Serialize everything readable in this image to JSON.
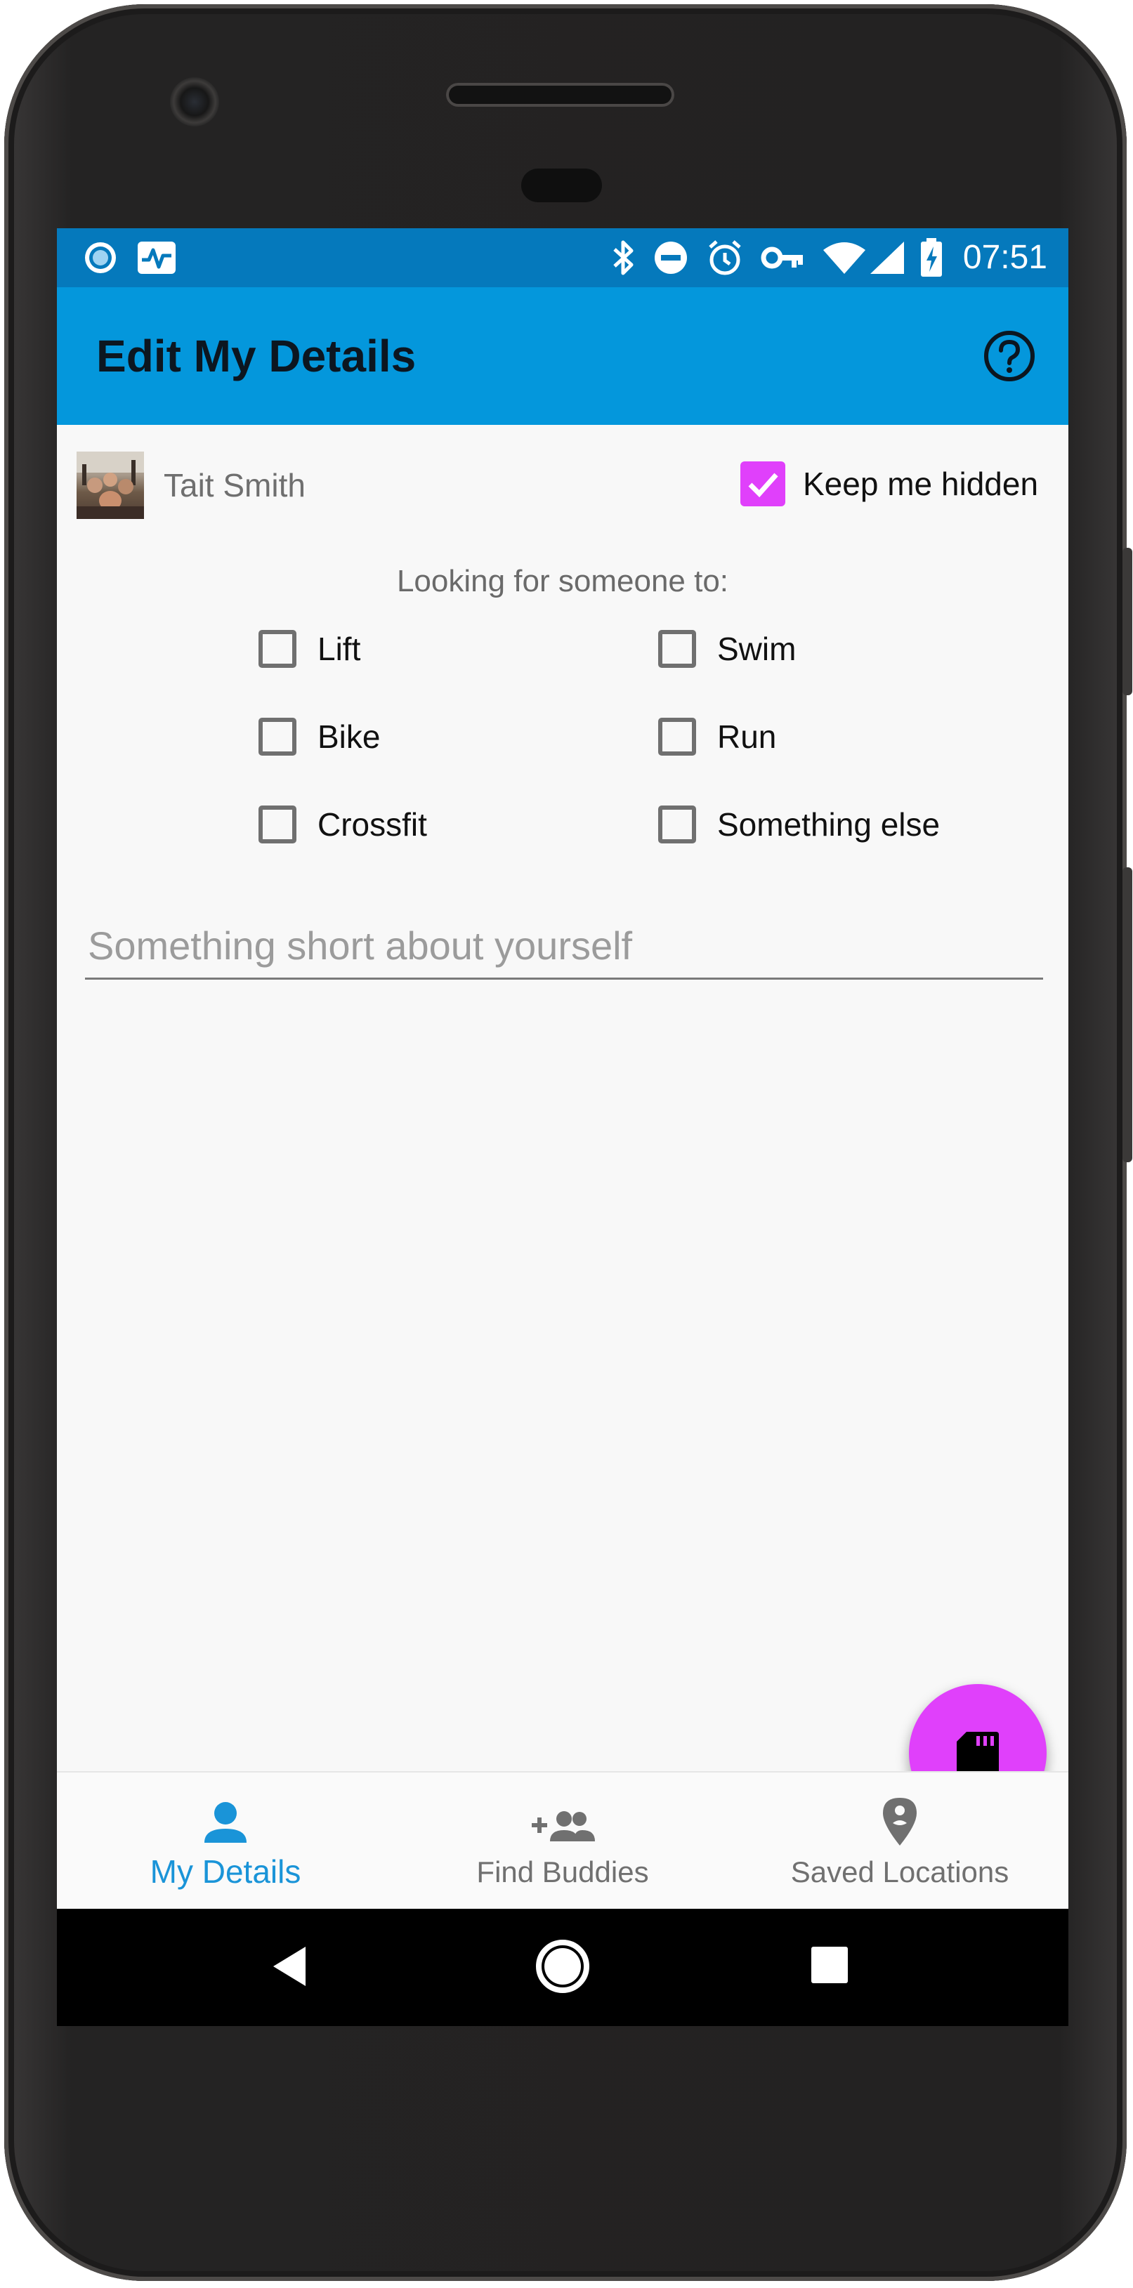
{
  "status_bar": {
    "time": "07:51",
    "icons": [
      "notification-circle-icon",
      "activity-monitor-icon",
      "bluetooth-icon",
      "do-not-disturb-icon",
      "alarm-icon",
      "vpn-key-icon",
      "wifi-icon",
      "cell-signal-icon",
      "battery-charging-icon"
    ]
  },
  "app_bar": {
    "title": "Edit My Details",
    "help_icon": "help-circle-icon"
  },
  "profile": {
    "name": "Tait Smith",
    "keep_hidden_label": "Keep me hidden",
    "keep_hidden_checked": true
  },
  "looking_for": {
    "title": "Looking for someone to:",
    "options": [
      {
        "label": "Lift",
        "checked": false
      },
      {
        "label": "Swim",
        "checked": false
      },
      {
        "label": "Bike",
        "checked": false
      },
      {
        "label": "Run",
        "checked": false
      },
      {
        "label": "Crossfit",
        "checked": false
      },
      {
        "label": "Something else",
        "checked": false
      }
    ]
  },
  "about": {
    "value": "",
    "placeholder": "Something short about yourself"
  },
  "fab": {
    "icon": "sd-card-icon"
  },
  "bottom_nav": {
    "items": [
      {
        "label": "My Details",
        "icon": "person-icon",
        "active": true
      },
      {
        "label": "Find Buddies",
        "icon": "add-group-icon",
        "active": false
      },
      {
        "label": "Saved Locations",
        "icon": "location-pin-icon",
        "active": false
      }
    ]
  },
  "system_nav": [
    "back-icon",
    "home-icon",
    "recents-icon"
  ],
  "colors": {
    "status_bar": "#0579bc",
    "app_bar": "#0497dc",
    "accent": "#e040fb",
    "active_nav": "#1a94d8"
  }
}
